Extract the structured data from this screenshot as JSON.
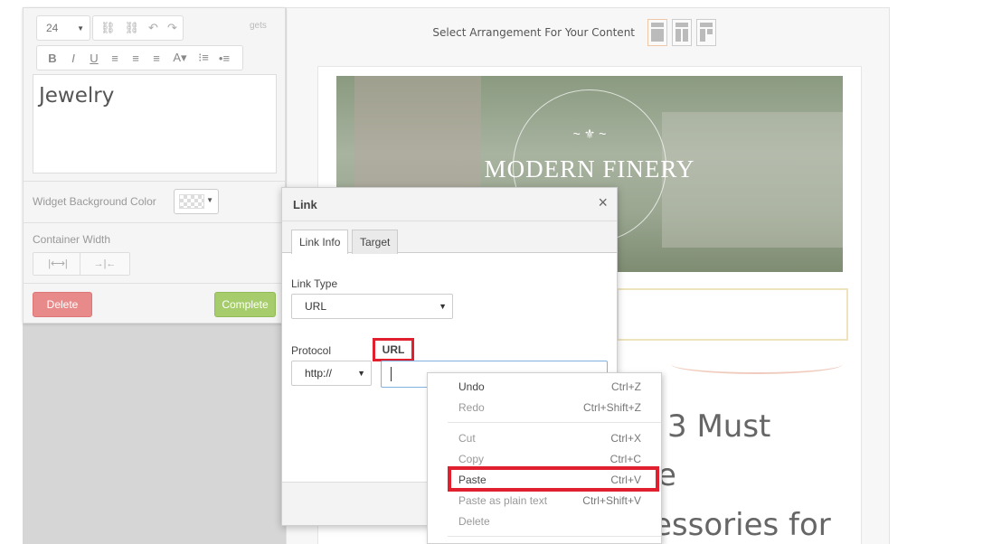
{
  "content_area": {
    "arrange_label": "Select Arrangement For Your Content",
    "hero_brand": "MODERN FINERY",
    "hero_ornament": "~ ⚜ ~",
    "big_text_lines": [
      "3 Must",
      "e",
      "essories for"
    ]
  },
  "editor": {
    "font_size": "24",
    "widgets_partial": "gets",
    "editor_text": "Jewelry",
    "widget_bg_label": "Widget Background Color",
    "container_width_label": "Container Width",
    "width_option_1": "|⟷|",
    "width_option_2": "→|←",
    "delete_label": "Delete",
    "complete_label": "Complete",
    "format_icons": [
      "B",
      "I",
      "U",
      "≡",
      "≡",
      "≡",
      "A▾",
      "⁝≡",
      "•≡"
    ]
  },
  "link_dialog": {
    "title": "Link",
    "close": "×",
    "tabs": [
      "Link Info",
      "Target"
    ],
    "link_type_label": "Link Type",
    "link_type_value": "URL",
    "protocol_label": "Protocol",
    "protocol_value": "http://",
    "url_label": "URL",
    "url_value": ""
  },
  "context_menu": {
    "items": [
      {
        "label": "Undo",
        "shortcut": "Ctrl+Z"
      },
      {
        "label": "Redo",
        "shortcut": "Ctrl+Shift+Z"
      },
      {
        "label": "Cut",
        "shortcut": "Ctrl+X"
      },
      {
        "label": "Copy",
        "shortcut": "Ctrl+C"
      },
      {
        "label": "Paste",
        "shortcut": "Ctrl+V"
      },
      {
        "label": "Paste as plain text",
        "shortcut": "Ctrl+Shift+V"
      },
      {
        "label": "Delete",
        "shortcut": ""
      }
    ]
  },
  "colors": {
    "highlight": "#e01f2f",
    "delete_button": "#e88a8a",
    "complete_button": "#a6cc6c"
  }
}
